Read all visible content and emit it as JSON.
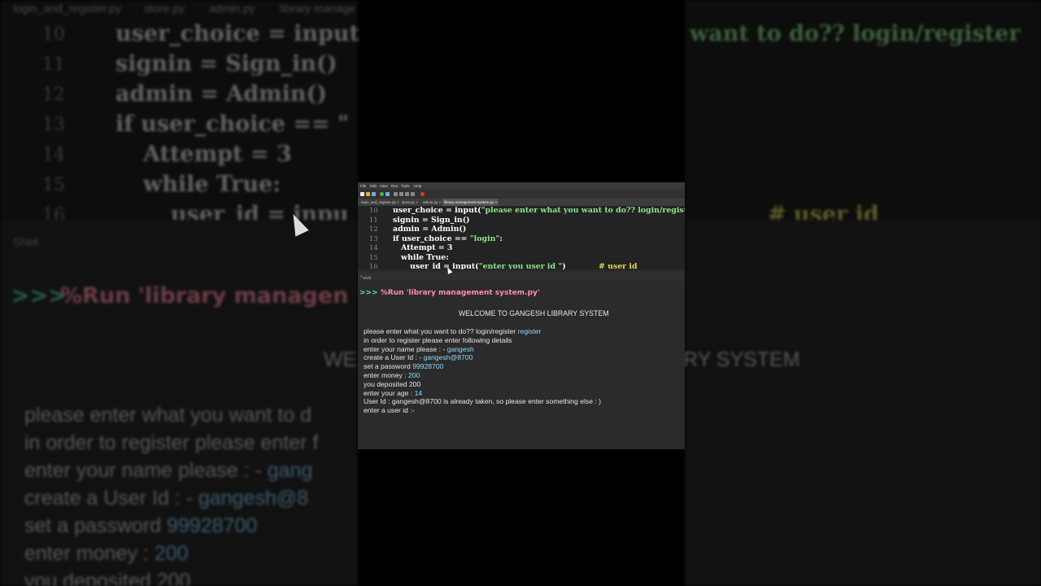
{
  "window": {
    "menu": [
      "File",
      "Edit",
      "View",
      "Run",
      "Tools",
      "Help"
    ],
    "tabs": [
      {
        "label": "login_and_register.py",
        "active": false
      },
      {
        "label": "store.py",
        "active": false
      },
      {
        "label": "admin.py",
        "active": false
      },
      {
        "label": "library management system.py",
        "active": true
      }
    ]
  },
  "bg_tabs": [
    "login_and_register.py",
    "store.py",
    "admin.py",
    "library manage"
  ],
  "editor": {
    "lines": [
      {
        "num": "10",
        "indent": 0,
        "code": "user_choice = input(",
        "str": "\"please enter what you want to do?? login/register",
        "cmt": ""
      },
      {
        "num": "11",
        "indent": 0,
        "code": "signin = Sign_in()",
        "str": "",
        "cmt": ""
      },
      {
        "num": "12",
        "indent": 0,
        "code": "admin = Admin()",
        "str": "",
        "cmt": ""
      },
      {
        "num": "13",
        "indent": 0,
        "code": "if user_choice == ",
        "str": "\"login\"",
        "code2": ":",
        "cmt": ""
      },
      {
        "num": "14",
        "indent": 1,
        "code": "Attempt = 3",
        "str": "",
        "cmt": ""
      },
      {
        "num": "15",
        "indent": 1,
        "code": "while True:",
        "str": "",
        "cmt": ""
      },
      {
        "num": "16",
        "indent": 2,
        "code": "user_id = input(",
        "str": "\"enter you user id \"",
        "code2": ")",
        "cmt": "# user id"
      }
    ]
  },
  "bg_editor": {
    "lines": [
      {
        "num": "10",
        "text": "user_choice = input"
      },
      {
        "num": "11",
        "text": "signin = Sign_in()"
      },
      {
        "num": "12",
        "text": "admin = Admin()"
      },
      {
        "num": "13",
        "text": "if user_choice == \""
      },
      {
        "num": "14",
        "text": "Attempt = 3"
      },
      {
        "num": "15",
        "text": "while True:"
      },
      {
        "num": "16",
        "text": "user_id = inpu"
      }
    ],
    "right_text": "want to do?? login/register",
    "right_cmt": "# user id"
  },
  "shell": {
    "tab_label": "Shell",
    "prompt": ">>>",
    "command": "%Run 'library management system.py'",
    "bg_command": "%Run 'library managen",
    "welcome": "WELCOME TO GANGESH LIBRARY SYSTEM",
    "bg_welcome_left": "WE",
    "bg_welcome_right": "RY SYSTEM",
    "output": [
      {
        "text": "please enter what you want to do?? login/register ",
        "input": "register"
      },
      {
        "text": "in order to register please enter following details",
        "input": ""
      },
      {
        "text": "enter your name please  : -  ",
        "input": "gangesh"
      },
      {
        "text": "create a User Id : -   ",
        "input": "gangesh@8700"
      },
      {
        "text": "set a  password ",
        "input": "99928700"
      },
      {
        "text": "enter money :  ",
        "input": "200"
      },
      {
        "text": "you deposited 200",
        "input": ""
      },
      {
        "text": "enter your age :  ",
        "input": "14"
      },
      {
        "text": " User Id : gangesh@8700 is already taken, so please enter something else : )",
        "input": ""
      },
      {
        "text": "enter a user id   :-",
        "input": ""
      }
    ],
    "bg_output": [
      {
        "text": "please enter what you want to d",
        "input": ""
      },
      {
        "text": "in order to register please enter f",
        "input": ""
      },
      {
        "text": "enter your name please  : -  ",
        "input": "gang"
      },
      {
        "text": "create a User Id : -   ",
        "input": "gangesh@8"
      },
      {
        "text": "set a  password ",
        "input": "99928700"
      },
      {
        "text": "enter money :  ",
        "input": "200"
      },
      {
        "text": "you deposited 200",
        "input": ""
      }
    ]
  },
  "colors": {
    "code": "#ffffff",
    "string": "#8fe38f",
    "comment": "#e5d65a",
    "prompt": "#5fe3c8",
    "run_command": "#ff8fa8",
    "user_input": "#8fd8ff",
    "shell_text": "#e8e8e8"
  }
}
